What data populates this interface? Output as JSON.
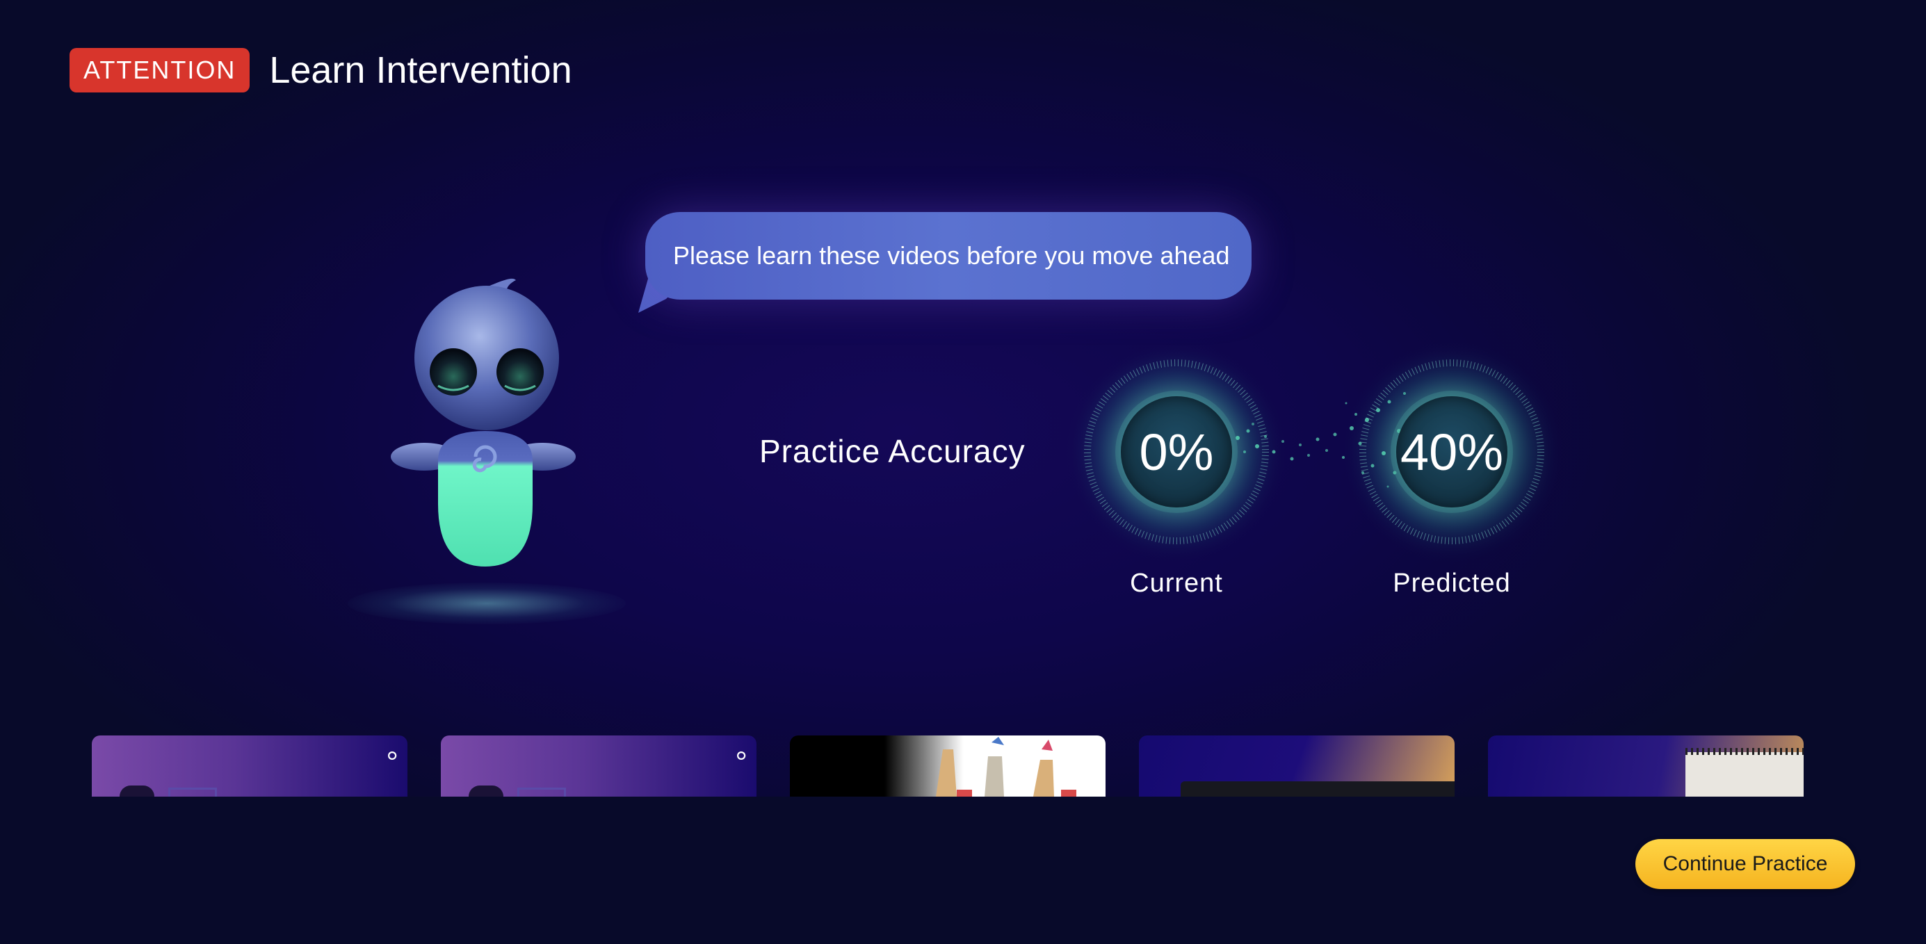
{
  "header": {
    "badge": "ATTENTION",
    "title": "Learn Intervention"
  },
  "bubble": {
    "message": "Please learn these videos before you move ahead"
  },
  "accuracy": {
    "label": "Practice Accuracy",
    "current": {
      "value": "0%",
      "caption": "Current"
    },
    "predicted": {
      "value": "40%",
      "caption": "Predicted"
    }
  },
  "thumbnails": [
    {
      "name": "video-thumbnail-1"
    },
    {
      "name": "video-thumbnail-2"
    },
    {
      "name": "video-thumbnail-3"
    },
    {
      "name": "video-thumbnail-4"
    },
    {
      "name": "video-thumbnail-5"
    }
  ],
  "actions": {
    "continue_label": "Continue Practice"
  },
  "colors": {
    "badge": "#d8352c",
    "button": "#f7c12c",
    "mascot_body": "#6df5c4",
    "dial_glow": "#5fe0b8"
  },
  "icons": {
    "mascot": "robot-mascot-icon",
    "thumb_logo": "swirl-logo-icon"
  }
}
